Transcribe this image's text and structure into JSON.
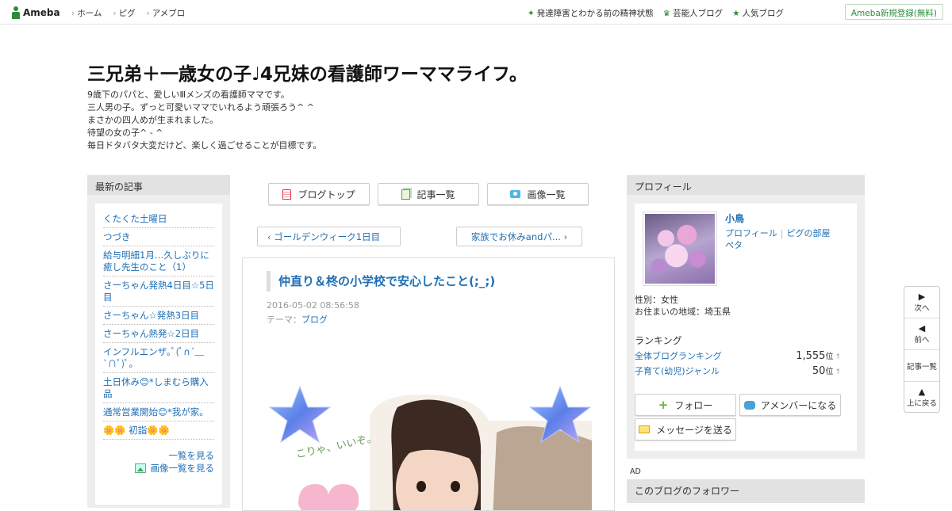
{
  "topbar": {
    "logo_text": "Ameba",
    "nav": [
      "ホーム",
      "ピグ",
      "アメブロ"
    ],
    "right_links": [
      {
        "icon": "sparkle-icon",
        "label": "発達障害とわかる前の精神状態"
      },
      {
        "icon": "crown-icon",
        "label": "芸能人ブログ"
      },
      {
        "icon": "star-icon",
        "label": "人気ブログ"
      }
    ],
    "signup_label": "Ameba新規登録(無料)"
  },
  "header": {
    "title": "三兄弟＋一歳女の子♩4兄妹の看護師ワーママライフ。",
    "description": [
      "9歳下のパパと、愛しいⅢメンズの看護師ママです。",
      "三人男の子。ずっと可愛いママでいれるよう頑張ろう^ ^",
      "まさかの四人めが生まれました。",
      "待望の女の子^ - ^",
      "毎日ドタバタ大変だけど、楽しく過ごせることが目標です。"
    ]
  },
  "left": {
    "heading": "最新の記事",
    "articles": [
      "くたくた土曜日",
      "つづき",
      "給与明細1月…久しぶりに癒し先生のこと（1）",
      "さーちゃん発熱4日目☆5日目",
      "さーちゃん☆発熱3日目",
      "さーちゃん熱発☆2日目",
      "インフルエンザ｡ﾟ(ﾟ∩´﹏`∩ﾟ)ﾟ｡",
      "土日休み😊*しまむら購入品",
      "通常営業開始😊*我が家。",
      "🌼🌼 初詣🌼🌼"
    ],
    "more_label": "一覧を見る",
    "more_images_label": "画像一覧を見る"
  },
  "center": {
    "buttons": [
      {
        "icon": "blog-top-icon",
        "label": "ブログトップ"
      },
      {
        "icon": "article-list-icon",
        "label": "記事一覧"
      },
      {
        "icon": "camera-icon",
        "label": "画像一覧"
      }
    ],
    "prev_label": "ゴールデンウィーク1日目",
    "next_label": "家族でお休みandパ...",
    "entry": {
      "title": "仲直り＆柊の小学校で安心したこと(;_;)",
      "date": "2016-05-02 08:56:58",
      "theme_label": "テーマ：",
      "theme": "ブログ",
      "photo_caption": "こりゃ、いいぞ。"
    }
  },
  "right": {
    "heading": "プロフィール",
    "name": "小鳥",
    "links": [
      "プロフィール",
      "ピグの部屋",
      "ペタ"
    ],
    "gender": "性別：女性",
    "region": "お住まいの地域：埼玉県",
    "ranking_title": "ランキング",
    "rankings": [
      {
        "label": "全体ブログランキング",
        "value": "1,555",
        "unit": "位",
        "arrow": "↑"
      },
      {
        "label": "子育て(幼児)ジャンル",
        "value": "50",
        "unit": "位",
        "arrow": "↑"
      }
    ],
    "follow_label": "フォロー",
    "amember_label": "アメンバーになる",
    "message_label": "メッセージを送る",
    "ad_label": "AD",
    "followers_heading": "このブログのフォロワー"
  },
  "sidenav": [
    {
      "icon": "triangle-right-icon",
      "glyph": "▶",
      "label": "次へ"
    },
    {
      "icon": "triangle-left-icon",
      "glyph": "◀",
      "label": "前へ"
    },
    {
      "icon": "",
      "glyph": "",
      "label": "記事一覧"
    },
    {
      "icon": "triangle-up-icon",
      "glyph": "▲",
      "label": "上に戻る"
    }
  ]
}
